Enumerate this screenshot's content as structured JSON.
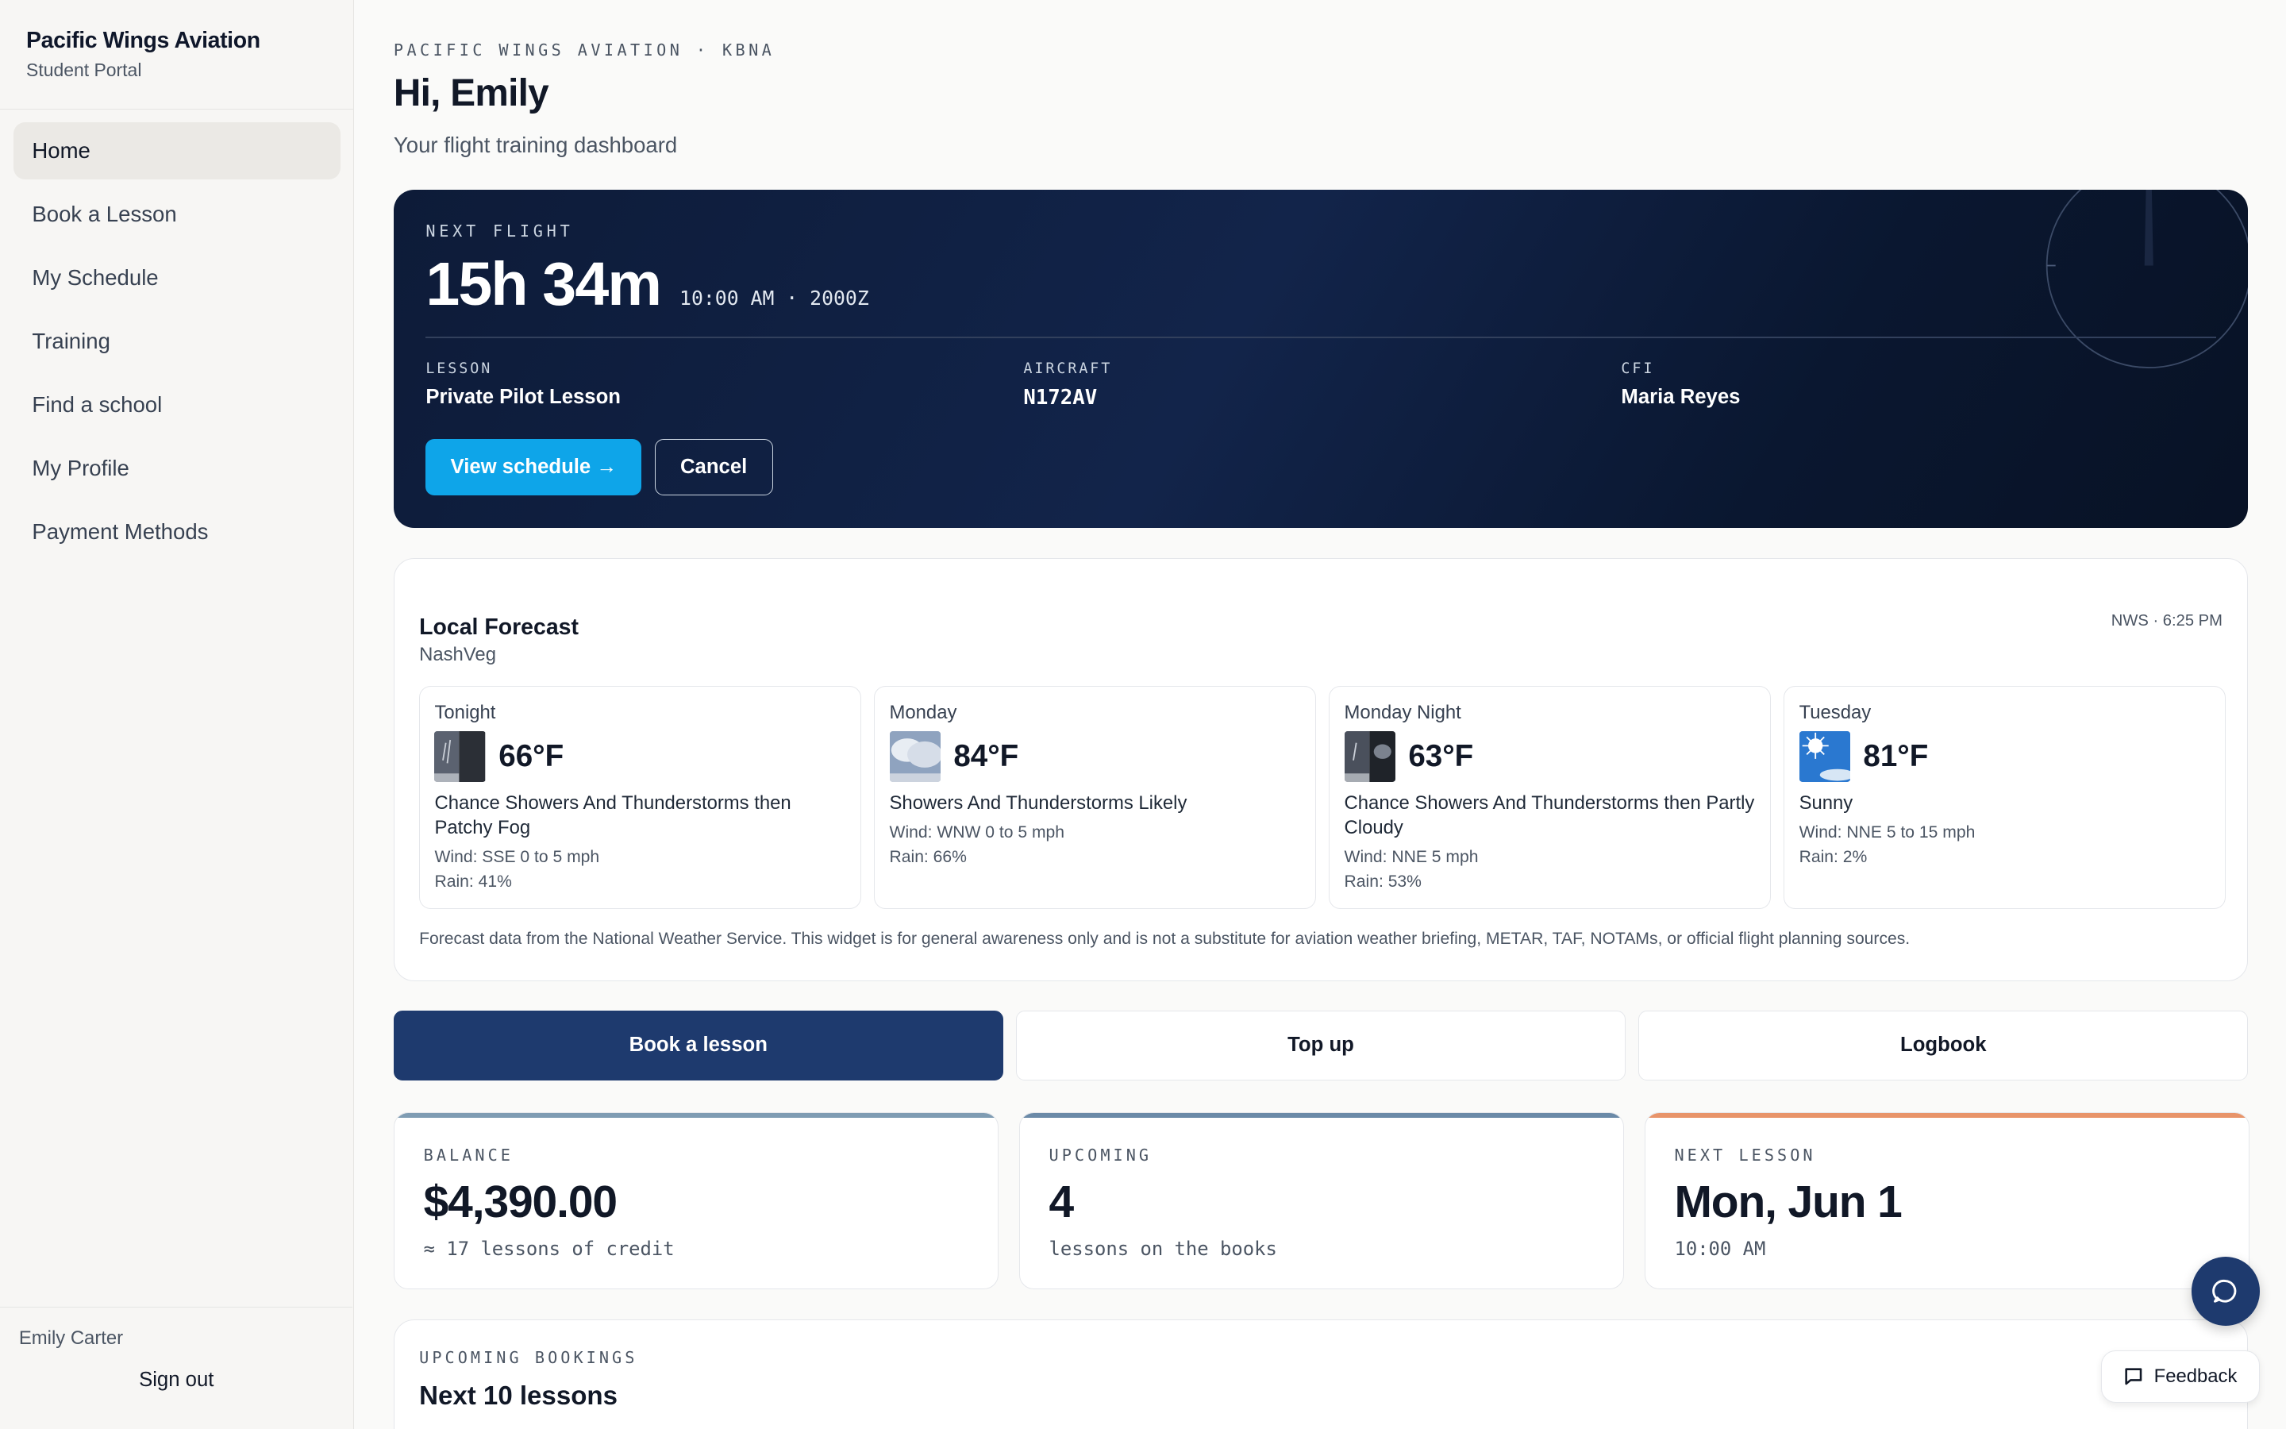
{
  "sidebar": {
    "brand_name": "Pacific Wings Aviation",
    "brand_sub": "Student Portal",
    "items": [
      {
        "label": "Home",
        "active": true
      },
      {
        "label": "Book a Lesson"
      },
      {
        "label": "My Schedule"
      },
      {
        "label": "Training"
      },
      {
        "label": "Find a school"
      },
      {
        "label": "My Profile"
      },
      {
        "label": "Payment Methods"
      }
    ],
    "user_name": "Emily Carter",
    "sign_out": "Sign out"
  },
  "header": {
    "eyebrow": "PACIFIC WINGS AVIATION · KBNA",
    "greeting": "Hi, Emily",
    "subtitle": "Your flight training dashboard"
  },
  "next_flight": {
    "label": "NEXT FLIGHT",
    "countdown": "15h 34m",
    "time": "10:00 AM · 2000Z",
    "lesson_label": "LESSON",
    "lesson": "Private Pilot Lesson",
    "aircraft_label": "AIRCRAFT",
    "aircraft": "N172AV",
    "cfi_label": "CFI",
    "cfi": "Maria Reyes",
    "view_button": "View schedule →",
    "cancel_button": "Cancel"
  },
  "forecast": {
    "title": "Local Forecast",
    "location": "NashVeg",
    "source": "NWS · 6:25 PM",
    "periods": [
      {
        "name": "Tonight",
        "temp": "66°F",
        "desc": "Chance Showers And Thunderstorms then Patchy Fog",
        "wind": "Wind: SSE 0 to 5 mph",
        "rain": "Rain: 41%",
        "icon": "storm-fog-icon"
      },
      {
        "name": "Monday",
        "temp": "84°F",
        "desc": "Showers And Thunderstorms Likely",
        "wind": "Wind: WNW 0 to 5 mph",
        "rain": "Rain: 66%",
        "icon": "thunderstorm-icon"
      },
      {
        "name": "Monday Night",
        "temp": "63°F",
        "desc": "Chance Showers And Thunderstorms then Partly Cloudy",
        "wind": "Wind: NNE 5 mph",
        "rain": "Rain: 53%",
        "icon": "storm-night-icon"
      },
      {
        "name": "Tuesday",
        "temp": "81°F",
        "desc": "Sunny",
        "wind": "Wind: NNE 5 to 15 mph",
        "rain": "Rain: 2%",
        "icon": "sunny-icon"
      }
    ],
    "note": "Forecast data from the National Weather Service. This widget is for general awareness only and is not a substitute for aviation weather briefing, METAR, TAF, NOTAMs, or official flight planning sources."
  },
  "actions": {
    "book": "Book a lesson",
    "top_up": "Top up",
    "logbook": "Logbook"
  },
  "stats": {
    "balance_label": "BALANCE",
    "balance": "$4,390.00",
    "balance_sub": "≈ 17 lessons of credit",
    "upcoming_label": "UPCOMING",
    "upcoming": "4",
    "upcoming_sub": "lessons on the books",
    "next_label": "NEXT LESSON",
    "next": "Mon, Jun 1",
    "next_sub": "10:00 AM",
    "accent_colors": [
      "#7f9cb3",
      "#6b8aa8",
      "#e8946a"
    ]
  },
  "bookings": {
    "label": "UPCOMING BOOKINGS",
    "title": "Next 10 lessons"
  },
  "feedback": "Feedback"
}
